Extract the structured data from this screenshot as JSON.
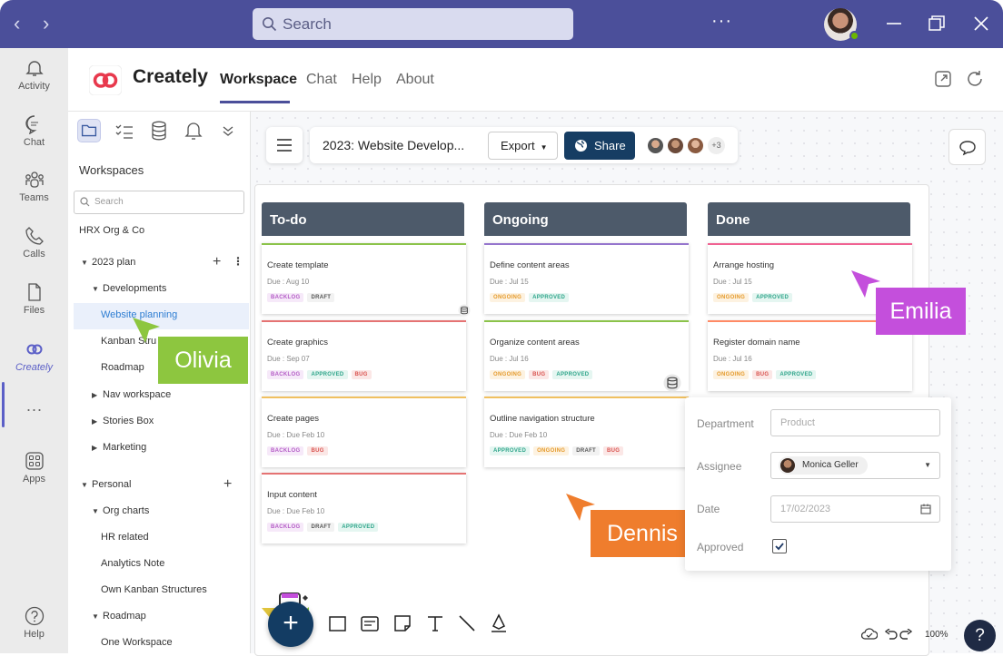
{
  "titlebar": {
    "search_placeholder": "Search",
    "more": "···"
  },
  "rail": {
    "items": [
      {
        "label": "Activity"
      },
      {
        "label": "Chat"
      },
      {
        "label": "Teams"
      },
      {
        "label": "Calls"
      },
      {
        "label": "Files"
      },
      {
        "label": "Creately"
      },
      {
        "label": "Apps"
      },
      {
        "label": "Help"
      }
    ],
    "more": "···",
    "accent": "#5b5fc7"
  },
  "header": {
    "brand": "Creately",
    "tabs": [
      {
        "label": "Workspace",
        "active": true
      },
      {
        "label": "Chat"
      },
      {
        "label": "Help"
      },
      {
        "label": "About"
      }
    ]
  },
  "sidebar": {
    "title": "Workspaces",
    "search_placeholder": "Search",
    "tree": [
      {
        "label": "HRX Org & Co"
      },
      {
        "label": "2023 plan"
      },
      {
        "label": "Developments"
      },
      {
        "label": "Website planning"
      },
      {
        "label": "Kanban Stru"
      },
      {
        "label": "Roadmap"
      },
      {
        "label": "Nav workspace"
      },
      {
        "label": "Stories Box"
      },
      {
        "label": "Marketing"
      },
      {
        "label": "Personal"
      },
      {
        "label": "Org charts"
      },
      {
        "label": "HR related"
      },
      {
        "label": "Analytics Note"
      },
      {
        "label": "Own Kanban Structures"
      },
      {
        "label": "Roadmap"
      },
      {
        "label": "One Workspace"
      }
    ]
  },
  "document": {
    "name": "2023: Website Develop...",
    "export_label": "Export",
    "share_label": "Share",
    "collaborators_more": "+3"
  },
  "board": {
    "columns": [
      {
        "title": "To-do",
        "cards": [
          {
            "title": "Create template",
            "due": "Due : Aug 10",
            "tags": [
              "BACKLOG",
              "DRAFT"
            ],
            "color": "#8bc34a"
          },
          {
            "title": "Create graphics",
            "due": "Due : Sep 07",
            "tags": [
              "BACKLOG",
              "APPROVED",
              "BUG"
            ],
            "color": "#e57373"
          },
          {
            "title": "Create pages",
            "due": "Due : Due Feb 10",
            "tags": [
              "BACKLOG",
              "BUG"
            ],
            "color": "#f0c060"
          },
          {
            "title": "Input content",
            "due": "Due : Due Feb 10",
            "tags": [
              "BACKLOG",
              "DRAFT",
              "APPROVED"
            ],
            "color": "#e57373"
          }
        ]
      },
      {
        "title": "Ongoing",
        "cards": [
          {
            "title": "Define content areas",
            "due": "Due : Jul 15",
            "tags": [
              "ONGOING",
              "APPROVED"
            ],
            "color": "#9575cd"
          },
          {
            "title": "Organize content areas",
            "due": "Due : Jul 16",
            "tags": [
              "ONGOING",
              "BUG",
              "APPROVED"
            ],
            "color": "#8bc34a"
          },
          {
            "title": "Outline navigation structure",
            "due": "Due : Due Feb 10",
            "tags": [
              "APPROVED",
              "ONGOING",
              "DRAFT",
              "BUG"
            ],
            "color": "#f0c060"
          }
        ]
      },
      {
        "title": "Done",
        "cards": [
          {
            "title": "Arrange hosting",
            "due": "Due : Jul 15",
            "tags": [
              "ONGOING",
              "APPROVED"
            ],
            "color": "#f06292"
          },
          {
            "title": "Register domain name",
            "due": "Due : Jul 16",
            "tags": [
              "ONGOING",
              "BUG",
              "APPROVED"
            ],
            "color": "#ff8a65"
          }
        ]
      }
    ]
  },
  "cursors": [
    {
      "name": "Olivia",
      "color": "#8dc63f"
    },
    {
      "name": "Emilia",
      "color": "#c44fdc"
    },
    {
      "name": "Dennis",
      "color": "#ef7d2d"
    }
  ],
  "form": {
    "department_label": "Department",
    "department_placeholder": "Product",
    "assignee_label": "Assignee",
    "assignee_value": "Monica Geller",
    "date_label": "Date",
    "date_value": "17/02/2023",
    "approved_label": "Approved",
    "approved": true
  },
  "footer": {
    "zoom": "100%",
    "help": "?"
  }
}
